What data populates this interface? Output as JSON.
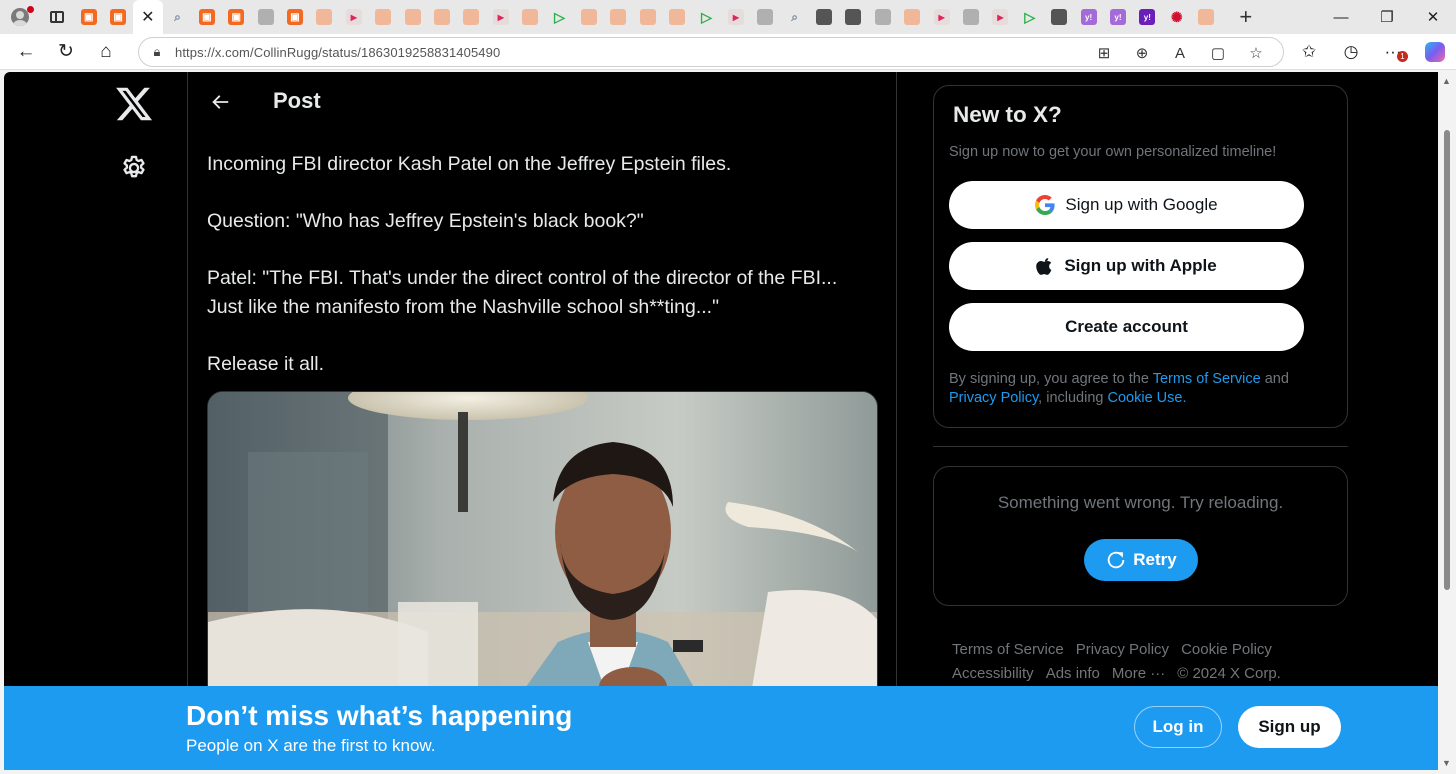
{
  "browser": {
    "url": "https://x.com/CollinRugg/status/1863019258831405490",
    "active_tab_close": "✕",
    "new_tab": "+"
  },
  "page": {
    "header_title": "Post",
    "post_paragraphs": [
      "Incoming FBI director Kash Patel on the Jeffrey Epstein files.",
      "Question: \"Who has Jeffrey Epstein's black book?\"",
      "Patel: \"The FBI. That's under the direct control of the director of the FBI... Just like the manifesto from the Nashville school sh**ting...\"",
      "Release it all."
    ]
  },
  "signup": {
    "title": "New to X?",
    "subtitle": "Sign up now to get your own personalized timeline!",
    "google_label": "Sign up with Google",
    "apple_label": "Sign up with Apple",
    "create_label": "Create account",
    "legal_prefix": "By signing up, you agree to the ",
    "terms_link": "Terms of Service",
    "legal_and": " and ",
    "privacy_link": "Privacy Policy",
    "legal_including": ", including ",
    "cookie_link": "Cookie Use",
    "legal_end": "."
  },
  "error_box": {
    "message": "Something went wrong. Try reloading.",
    "retry_label": "Retry"
  },
  "footer": {
    "links": [
      "Terms of Service",
      "Privacy Policy",
      "Cookie Policy",
      "Accessibility",
      "Ads info",
      "More ···"
    ],
    "copyright": "© 2024 X Corp."
  },
  "banner": {
    "headline": "Don’t miss what’s happening",
    "subline": "People on X are the first to know.",
    "login_label": "Log in",
    "signup_label": "Sign up"
  },
  "colors": {
    "accent": "#1d9bf0",
    "background": "#000000",
    "text_primary": "#e7e9ea",
    "text_secondary": "#71767b"
  }
}
